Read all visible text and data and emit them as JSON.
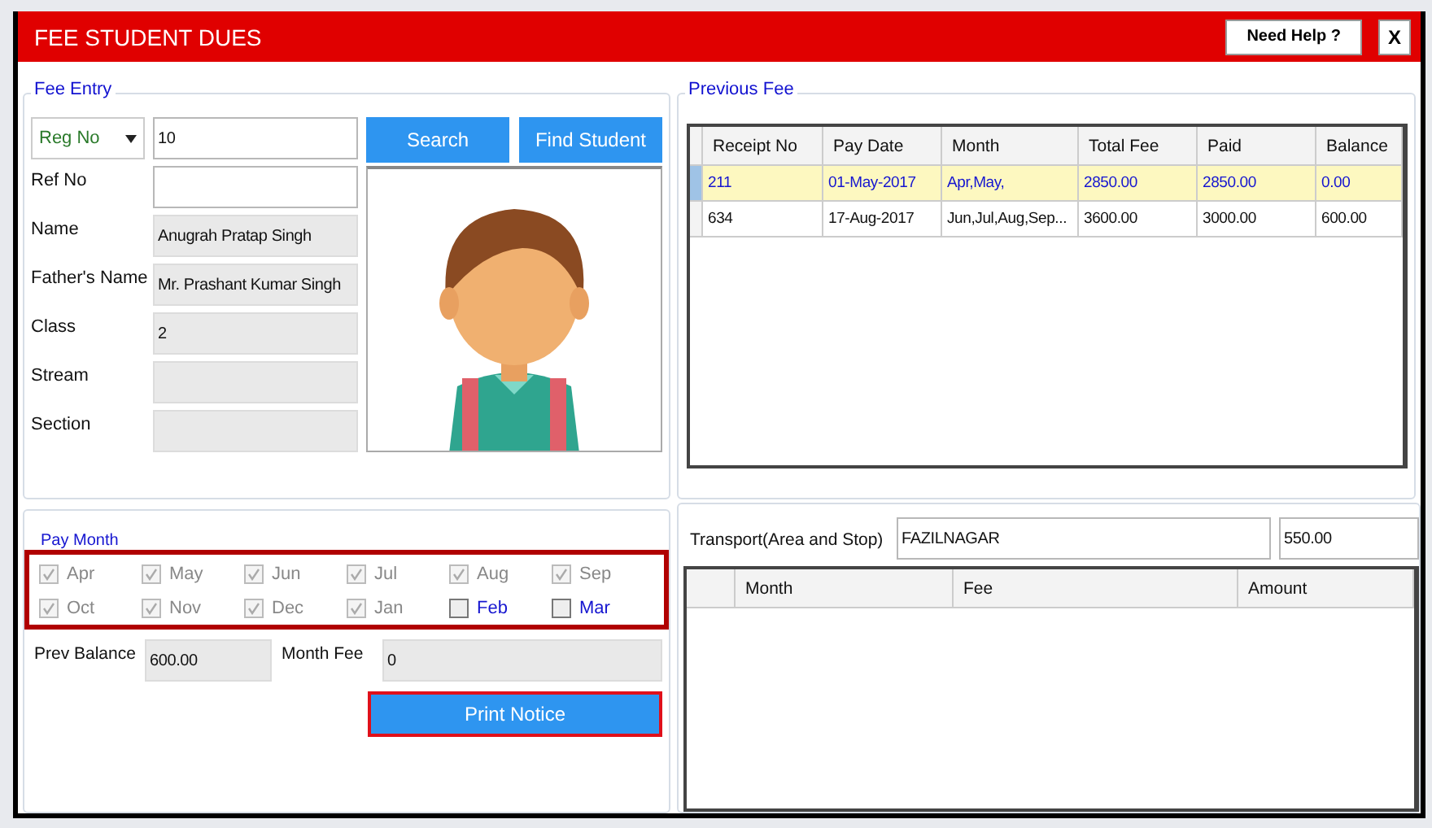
{
  "window": {
    "title": "FEE STUDENT DUES",
    "help_button": "Need Help ?",
    "close_button": "X"
  },
  "fee_entry": {
    "title": "Fee Entry",
    "search_by": "Reg No",
    "search_value": "10",
    "buttons": [
      "Search",
      "Find Student"
    ],
    "fields": [
      {
        "label": "Ref No",
        "disabled": false
      },
      {
        "label": "Name",
        "value": "Anugrah Pratap Singh",
        "disabled": true
      },
      {
        "label": "Father's Name",
        "value": "Mr. Prashant Kumar Singh",
        "disabled": true
      },
      {
        "label": "Class",
        "value": "2",
        "disabled": true
      },
      {
        "label": "Stream",
        "disabled": true
      },
      {
        "label": "Section",
        "disabled": true
      }
    ],
    "photo": {
      "kind": "picture"
    }
  },
  "previous_fee": {
    "title": "Previous Fee",
    "columns": [
      "Receipt No",
      "Pay Date",
      "Month",
      "Total Fee",
      "Paid",
      "Balance"
    ],
    "rows": [
      {
        "selected": true,
        "cells": [
          "211",
          "01-May-2017",
          "Apr,May,",
          "2850.00",
          "2850.00",
          "0.00"
        ]
      },
      {
        "selected": false,
        "cells": [
          "634",
          "17-Aug-2017",
          "Jun,Jul,Aug,Sep...",
          "3600.00",
          "3000.00",
          "600.00"
        ]
      }
    ]
  },
  "pay_month": {
    "title": "Pay Month",
    "highlighted": true,
    "months": [
      {
        "label": "Apr",
        "checked": true
      },
      {
        "label": "May",
        "checked": true
      },
      {
        "label": "Jun",
        "checked": true
      },
      {
        "label": "Jul",
        "checked": true
      },
      {
        "label": "Aug",
        "checked": true
      },
      {
        "label": "Sep",
        "checked": true
      },
      {
        "label": "Oct",
        "checked": true
      },
      {
        "label": "Nov",
        "checked": true
      },
      {
        "label": "Dec",
        "checked": true
      },
      {
        "label": "Jan",
        "checked": true
      },
      {
        "label": "Feb",
        "checked": false
      },
      {
        "label": "Mar",
        "checked": false
      }
    ]
  },
  "summary": {
    "prev_balance": {
      "label": "Prev Balance",
      "value": "600.00"
    },
    "month_fee": {
      "label": "Month Fee",
      "value": "0"
    },
    "print_button": {
      "label": "Print Notice",
      "highlighted": true
    }
  },
  "transport": {
    "label": "Transport(Area and Stop)",
    "area": "FAZILNAGAR",
    "amount": "550.00",
    "columns": [
      "Month",
      "Fee",
      "Amount"
    ]
  }
}
